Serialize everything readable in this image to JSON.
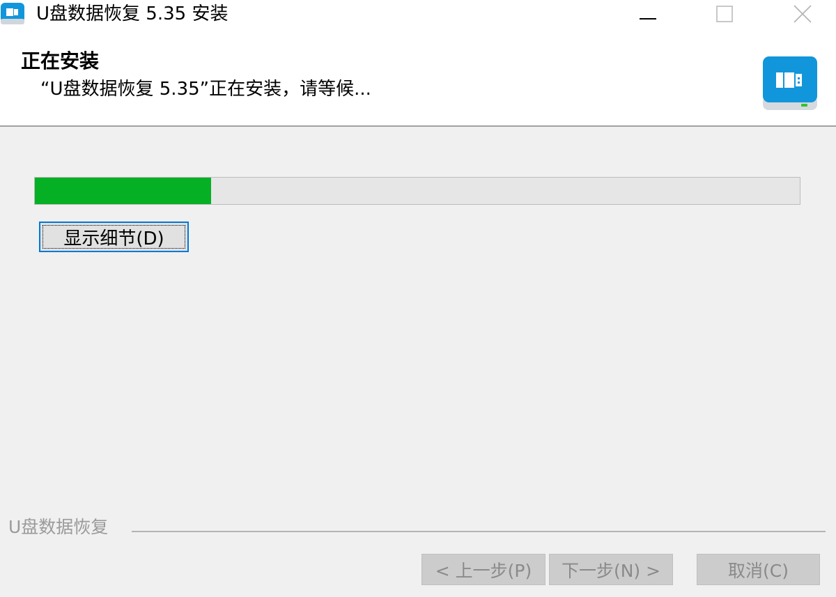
{
  "window": {
    "title": "U盘数据恢复 5.35 安装"
  },
  "title_bar_icons": {
    "app": "app-icon",
    "minimize": "minimize-icon",
    "maximize": "maximize-icon",
    "close": "close-icon"
  },
  "header": {
    "title": "正在安装",
    "subtitle": "“U盘数据恢复 5.35”正在安装，请等候...",
    "logo_icon": "usb-drive-logo-icon",
    "accent_color": "#1296db"
  },
  "progress": {
    "percent": 23,
    "fill_color": "#06b025"
  },
  "details_button": {
    "label": "显示细节(D)"
  },
  "branding": {
    "text": "U盘数据恢复"
  },
  "buttons": {
    "back_label": "< 上一步(P)",
    "next_label": "下一步(N) >",
    "cancel_label": "取消(C)"
  }
}
